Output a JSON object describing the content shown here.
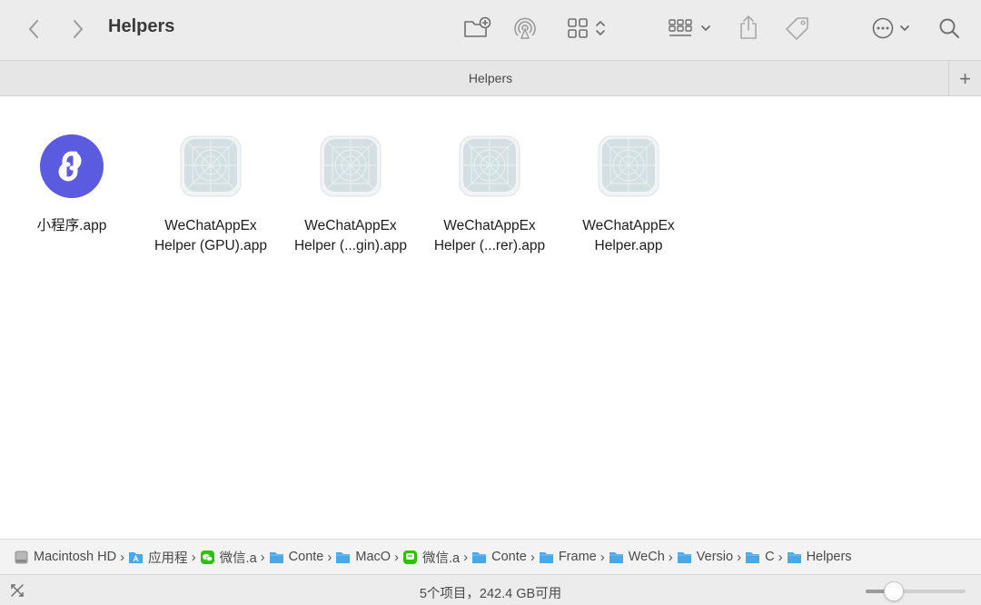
{
  "window": {
    "title": "Helpers"
  },
  "toolbar": {
    "back_icon": "chevron-left-icon",
    "forward_icon": "chevron-right-icon",
    "new_folder_icon": "new-folder-icon",
    "airdrop_icon": "airdrop-icon",
    "view_icon": "icon-grid-view-icon",
    "group_icon": "group-by-icon",
    "share_icon": "share-icon",
    "tag_icon": "tag-icon",
    "more_icon": "ellipsis-circle-icon",
    "search_icon": "search-icon"
  },
  "tab": {
    "label": "Helpers",
    "add_label": "+"
  },
  "files": [
    {
      "name_lines": [
        "小程序.app"
      ],
      "icon": "mini-program-app-icon"
    },
    {
      "name_lines": [
        "WeChatAppEx",
        "Helper (GPU).app"
      ],
      "icon": "generic-app-icon"
    },
    {
      "name_lines": [
        "WeChatAppEx",
        "Helper (...gin).app"
      ],
      "icon": "generic-app-icon"
    },
    {
      "name_lines": [
        "WeChatAppEx",
        "Helper (...rer).app"
      ],
      "icon": "generic-app-icon"
    },
    {
      "name_lines": [
        "WeChatAppEx",
        "Helper.app"
      ],
      "icon": "generic-app-icon"
    }
  ],
  "path": [
    {
      "label": "Macintosh HD",
      "icon": "hard-drive-icon"
    },
    {
      "label": "应用程",
      "icon": "applications-folder-icon"
    },
    {
      "label": "微信.a",
      "icon": "wechat-icon"
    },
    {
      "label": "Conte",
      "icon": "folder-icon"
    },
    {
      "label": "MacO",
      "icon": "folder-icon"
    },
    {
      "label": "微信.a",
      "icon": "wechat-green-icon"
    },
    {
      "label": "Conte",
      "icon": "folder-icon"
    },
    {
      "label": "Frame",
      "icon": "folder-icon"
    },
    {
      "label": "WeCh",
      "icon": "folder-icon"
    },
    {
      "label": "Versio",
      "icon": "folder-icon"
    },
    {
      "label": "C",
      "icon": "folder-icon"
    },
    {
      "label": "Helpers",
      "icon": "folder-icon"
    }
  ],
  "path_separator": "›",
  "status": {
    "text": "5个项目，242.4 GB可用",
    "icon_size": 0.28
  },
  "colors": {
    "accent": "#5B5BE0",
    "folder": "#4AA8E8",
    "wechat": "#2DC100"
  }
}
